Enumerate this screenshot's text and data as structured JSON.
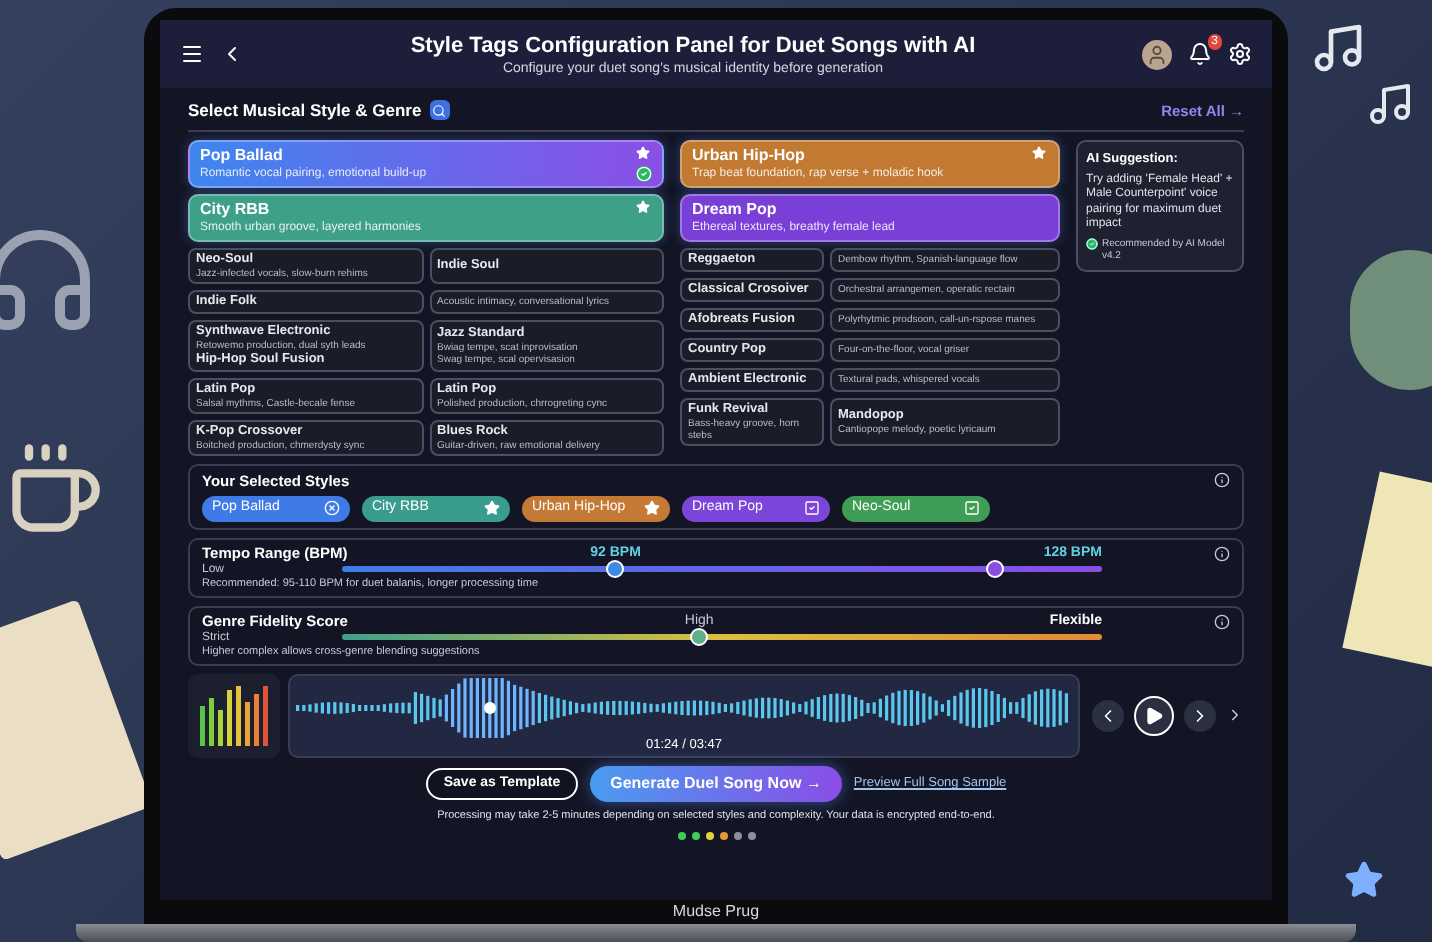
{
  "header": {
    "title": "Style Tags Configuration Panel for Duet Songs with AI",
    "subtitle": "Configure your duet song's musical identity before generation",
    "notifications": "3"
  },
  "genre_section": {
    "title": "Select Musical Style & Genre",
    "reset": "Reset All →"
  },
  "featured_left": [
    {
      "title": "Pop Ballad",
      "desc": "Romantic vocal pairing, emotional build-up",
      "color": "#3f86ee",
      "starred": true,
      "checked": true
    },
    {
      "title": "City RBB",
      "desc": "Smooth urban groove, layered harmonies",
      "color": "#3fa08a",
      "starred": true,
      "checked": false
    }
  ],
  "featured_right": [
    {
      "title": "Urban Hip-Hop",
      "desc": "Trap beat foundation, rap verse + moladic hook",
      "color": "#c27a33",
      "starred": true,
      "checked": false
    },
    {
      "title": "Dream Pop",
      "desc": "Ethereal textures, breathy female lead",
      "color": "#7a3fd6",
      "starred": false,
      "checked": false
    }
  ],
  "left_rows": [
    [
      {
        "lines": [
          {
            "kind": "title",
            "text": "Neo-Soul"
          },
          {
            "kind": "desc",
            "text": "Jazz-infected vocals, slow-burn rehims"
          }
        ]
      },
      {
        "lines": [
          {
            "kind": "title",
            "text": "Indie Soul"
          }
        ]
      }
    ],
    [
      {
        "lines": [
          {
            "kind": "title",
            "text": "Indie Folk"
          }
        ]
      },
      {
        "lines": [
          {
            "kind": "desc",
            "text": "Acoustic intimacy, conversational lyrics"
          }
        ]
      }
    ],
    [
      {
        "lines": [
          {
            "kind": "title",
            "text": "Synthwave Electronic"
          },
          {
            "kind": "desc",
            "text": "Retowemo production, dual syth leads"
          },
          {
            "kind": "title",
            "text": "Hip-Hop Soul Fusion"
          }
        ]
      },
      {
        "lines": [
          {
            "kind": "title",
            "text": "Jazz Standard"
          },
          {
            "kind": "desc",
            "text": "Bwiag tempe, scat inprovisation"
          },
          {
            "kind": "desc",
            "text": "Swag tempe, scal opervisasion"
          }
        ]
      }
    ],
    [
      {
        "lines": [
          {
            "kind": "title",
            "text": "Latin Pop"
          },
          {
            "kind": "desc",
            "text": "Salsal mythms, Castle-becale fense"
          }
        ]
      },
      {
        "lines": [
          {
            "kind": "title",
            "text": "Latin Pop"
          },
          {
            "kind": "desc",
            "text": "Polished production, chrrogreting cync"
          }
        ]
      }
    ],
    [
      {
        "lines": [
          {
            "kind": "title",
            "text": "K-Pop Crossover"
          },
          {
            "kind": "desc",
            "text": "Boitched production, chmerdysty sync"
          }
        ]
      },
      {
        "lines": [
          {
            "kind": "title",
            "text": "Blues Rock"
          },
          {
            "kind": "desc",
            "text": "Guitar-driven, raw emotional delivery"
          }
        ]
      }
    ]
  ],
  "right_rows": [
    [
      {
        "lines": [
          {
            "kind": "title",
            "text": "Reggaeton"
          }
        ]
      },
      {
        "lines": [
          {
            "kind": "desc",
            "text": "Dembow rhythm, Spanish-language flow"
          }
        ]
      }
    ],
    [
      {
        "lines": [
          {
            "kind": "title",
            "text": "Classical Crosoiver"
          }
        ]
      },
      {
        "lines": [
          {
            "kind": "desc",
            "text": "Orchestral arrangemen, operatic rectain"
          }
        ]
      }
    ],
    [
      {
        "lines": [
          {
            "kind": "title",
            "text": "Afobreats Fusion"
          }
        ]
      },
      {
        "lines": [
          {
            "kind": "desc",
            "text": "Polyrhytmic prodsoon, call-un-rspose manes"
          }
        ]
      }
    ],
    [
      {
        "lines": [
          {
            "kind": "title",
            "text": "Country Pop"
          }
        ]
      },
      {
        "lines": [
          {
            "kind": "desc",
            "text": "Four-on-the-floor, vocal griser"
          }
        ]
      }
    ],
    [
      {
        "lines": [
          {
            "kind": "title",
            "text": "Ambient Electronic"
          }
        ]
      },
      {
        "lines": [
          {
            "kind": "desc",
            "text": "Textural pads, whispered vocals"
          }
        ]
      }
    ],
    [
      {
        "lines": [
          {
            "kind": "title",
            "text": "Funk Revival"
          },
          {
            "kind": "desc",
            "text": "Bass-heavy groove, horn stebs"
          }
        ]
      },
      {
        "lines": [
          {
            "kind": "title",
            "text": "Mandopop"
          },
          {
            "kind": "desc",
            "text": "Cantiopope melody, poetic lyricaum"
          }
        ]
      }
    ]
  ],
  "ai_suggestion": {
    "title": "AI Suggestion:",
    "text": "Try adding 'Female Head' + Male Counterpoint' voice pairing for maximum duet impact",
    "footer": "Recommended by AI Model v4.2"
  },
  "selected_styles": {
    "title": "Your Selected Styles",
    "chips": [
      {
        "label": "Pop Ballad",
        "color": "#3f7be6",
        "kind": "removable"
      },
      {
        "label": "City RBB",
        "color": "#3a9c8c",
        "kind": "starred"
      },
      {
        "label": "Urban Hip-Hop",
        "color": "#c47a35",
        "kind": "starred"
      },
      {
        "label": "Dream Pop",
        "color": "#7a45d8",
        "kind": "checkbox"
      },
      {
        "label": "Neo-Soul",
        "color": "#3f9e55",
        "kind": "checkbox"
      }
    ]
  },
  "tempo": {
    "title": "Tempo Range (BPM)",
    "min_label": "Low",
    "value_label": "92 BPM",
    "max_label": "128 BPM",
    "thumbs": [
      {
        "level": 0.36
      },
      {
        "level": 0.86
      }
    ],
    "note": "Recommended: 95-110 BPM for duet balanis, longer processing time"
  },
  "fidelity": {
    "title": "Genre Fidelity Score",
    "min_label": "Strict",
    "value_label": "High",
    "max_label": "Flexible",
    "level": 0.47,
    "note": "Higher complex allows cross-genre blending suggestions"
  },
  "player": {
    "time": "01:24 / 03:47",
    "level": 0.25
  },
  "actions": {
    "secondary": "Save as Template",
    "primary": "Generate Duel Song Now →",
    "link": "Preview Full Song Sample",
    "note": "Processing may take 2-5 minutes depending on selected styles and complexity. Your data is encrypted end-to-end."
  },
  "steps": [
    {
      "color": "#3ecf5a"
    },
    {
      "color": "#3ecf5a"
    },
    {
      "color": "#e6d23a"
    },
    {
      "color": "#e8963a"
    },
    {
      "color": "#8a8f9c"
    },
    {
      "color": "#8a8f9c"
    }
  ],
  "laptop_label": "Mudse Prug"
}
